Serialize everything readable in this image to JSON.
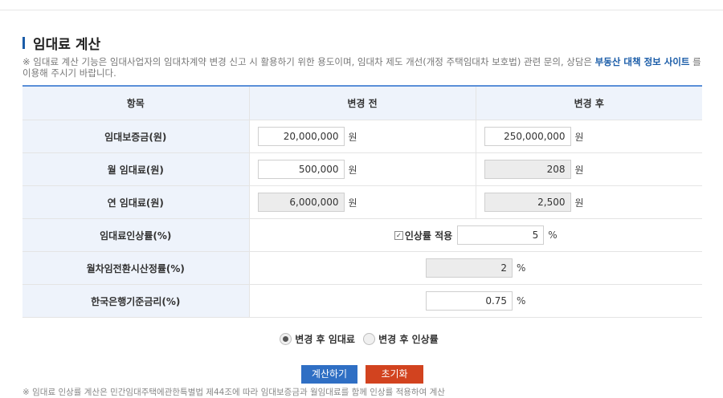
{
  "page": {
    "title": "임대료 계산",
    "notice_text": "※ 임대료 계산 기능은 임대사업자의 임대차계약 변경 신고 시 활용하기 위한 용도이며, 임대차 제도 개선(개정 주택임대차 보호법) 관련 문의, 상담은 ",
    "notice_link": "부동산 대책 정보 사이트",
    "notice_suffix": " 를 이용해 주시기 바랍니다."
  },
  "table": {
    "headers": [
      "항목",
      "변경 전",
      "변경 후"
    ],
    "rows": {
      "deposit": {
        "label": "임대보증금(원)",
        "before": "20,000,000",
        "after": "250,000,000",
        "unit": "원"
      },
      "monthly": {
        "label": "월 임대료(원)",
        "before": "500,000",
        "after": "208",
        "unit": "원"
      },
      "yearly": {
        "label": "연 임대료(원)",
        "before": "6,000,000",
        "after": "2,500",
        "unit": "원"
      },
      "increase": {
        "label": "임대료인상률(%)",
        "checkbox_label": "인상률 적용",
        "value": "5",
        "unit": "%"
      },
      "conversion": {
        "label": "월차임전환시산정률(%)",
        "value": "2",
        "unit": "%"
      },
      "bok": {
        "label": "한국은행기준금리(%)",
        "value": "0.75",
        "unit": "%"
      }
    }
  },
  "options": {
    "radio1": "변경 후 임대료",
    "radio2": "변경 후 인상률"
  },
  "buttons": {
    "calculate": "계산하기",
    "reset": "초기화"
  },
  "footnote": "※ 임대료 인상률 계산은 민간임대주택에관한특별법 제44조에 따라 임대보증금과 월임대료를 함께 인상률 적용하여 계산"
}
